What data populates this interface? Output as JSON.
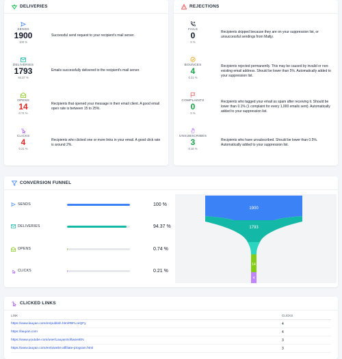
{
  "deliveries": {
    "title": "DELIVERIES",
    "metrics": [
      {
        "name": "SENDS",
        "value": "1900",
        "pct": "100 %",
        "desc": "Successful send request to your recipient's mail server.",
        "icon": "send-icon"
      },
      {
        "name": "DELIVERIES",
        "value": "1793",
        "pct": "94.37 %",
        "desc": "Emails successfully delivered to the recipient's mail server.",
        "icon": "envelope-check-icon"
      },
      {
        "name": "OPENS",
        "value": "14",
        "pct": "0.74 %",
        "desc": "Recipients that opened your message in their email client. A good email open rate is between 15 to 25%.",
        "icon": "envelope-open-icon"
      },
      {
        "name": "CLICKS",
        "value": "4",
        "pct": "0.21 %",
        "desc": "Recipients who clicked one or more links in your email. A good click rate is around 2%.",
        "icon": "cursor-click-icon"
      }
    ]
  },
  "rejections": {
    "title": "REJECTIONS",
    "metrics": [
      {
        "name": "FAILS",
        "value": "0",
        "pct": "0 %",
        "desc": "Recipients skipped because they are on your suppression list, or unsuccessful sendings from Mailjy.",
        "icon": "phone-x-icon"
      },
      {
        "name": "BOUNCES",
        "value": "4",
        "pct": "0.21 %",
        "desc": "Recipients rejected permanently. This may be caused by invalid or non-existing email address. Should be lower than 5%. Automatically added to your suppression list.",
        "icon": "bounce-icon"
      },
      {
        "name": "COMPLAINTS",
        "value": "0",
        "pct": "0 %",
        "desc": "Recipients who tagged your email as spam after receiving it. Should be lower than 0.1% (1 complaint for every 1,000 emails sent). Automatically added to your suppression list.",
        "icon": "flag-icon"
      },
      {
        "name": "UNSUBSCRIBES",
        "value": "3",
        "pct": "0.16 %",
        "desc": "Recipients who have unsubscribed. Should be lower than 0.5%. Automatically added to your suppression list.",
        "icon": "hand-icon"
      }
    ]
  },
  "funnel": {
    "title": "CONVERSION FUNNEL",
    "rows": [
      {
        "label": "SENDS",
        "pct": "100 %",
        "fill": 1.0,
        "color": "#3b82f6",
        "icon": "send-icon"
      },
      {
        "label": "DELIVERIES",
        "pct": "94.37 %",
        "fill": 0.9437,
        "color": "#14b8a6",
        "icon": "envelope-check-icon"
      },
      {
        "label": "OPENS",
        "pct": "0.74 %",
        "fill": 0.0074,
        "color": "#84cc16",
        "icon": "envelope-open-icon"
      },
      {
        "label": "CLICKS",
        "pct": "0.21 %",
        "fill": 0.0021,
        "color": "#c084fc",
        "icon": "cursor-click-icon"
      }
    ],
    "chart_labels": [
      "1900",
      "1793",
      "14",
      "4"
    ]
  },
  "links": {
    "title": "CLICKED LINKS",
    "col_link": "LINK",
    "col_clicks": "CLICKS",
    "rows": [
      {
        "url": "https://www.lauyan.com/en/publish.html#BFLceQFy",
        "clicks": "4"
      },
      {
        "url": "https://lauyan.com",
        "clicks": "4"
      },
      {
        "url": "https://www.youtube.com/user/LauyanSoftwareEN",
        "clicks": "3"
      },
      {
        "url": "https://www.lauyan.com/en/towebs-affiliate-program.html",
        "clicks": "3"
      }
    ]
  }
}
